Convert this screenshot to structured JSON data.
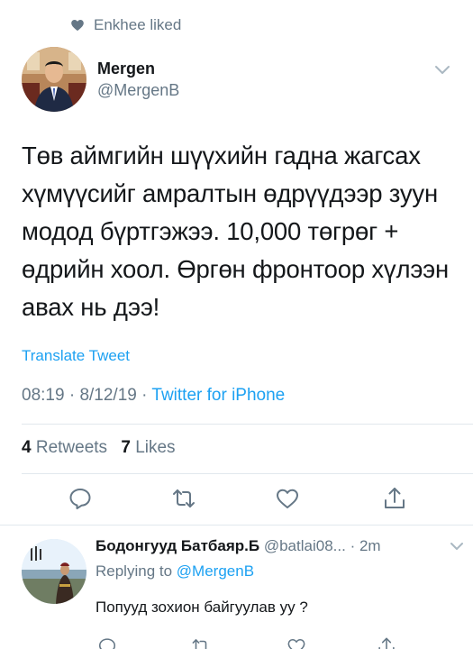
{
  "social_context": {
    "text": "Enkhee liked",
    "icon": "heart-icon"
  },
  "tweet": {
    "author_name": "Mergen",
    "author_handle": "@MergenB",
    "text": "Төв аймгийн шүүхийн гадна жагсах хүмүүсийг амралтын өдрүүдээр зуун модод бүртгэжээ. 10,000 төгрөг + өдрийн хоол. Өргөн фронтоор хүлээн авах нь дээ!",
    "translate_label": "Translate Tweet",
    "time": "08:19",
    "date": "8/12/19",
    "source": "Twitter for iPhone",
    "retweets_count": "4",
    "retweets_label": "Retweets",
    "likes_count": "7",
    "likes_label": "Likes"
  },
  "actions": [
    "reply-icon",
    "retweet-icon",
    "like-icon",
    "share-icon"
  ],
  "reply": {
    "author_name": "Бодонгууд Батбаяр.Б",
    "author_handle": "@batlai08...",
    "time": "2m",
    "replying_prefix": "Replying to",
    "replying_to": "@MergenB",
    "text": "Попууд зохион байгуулав уу ?"
  },
  "colors": {
    "accent": "#1da1f2",
    "secondary_text": "#657786",
    "primary_text": "#14171a",
    "divider": "#e1e8ed"
  }
}
